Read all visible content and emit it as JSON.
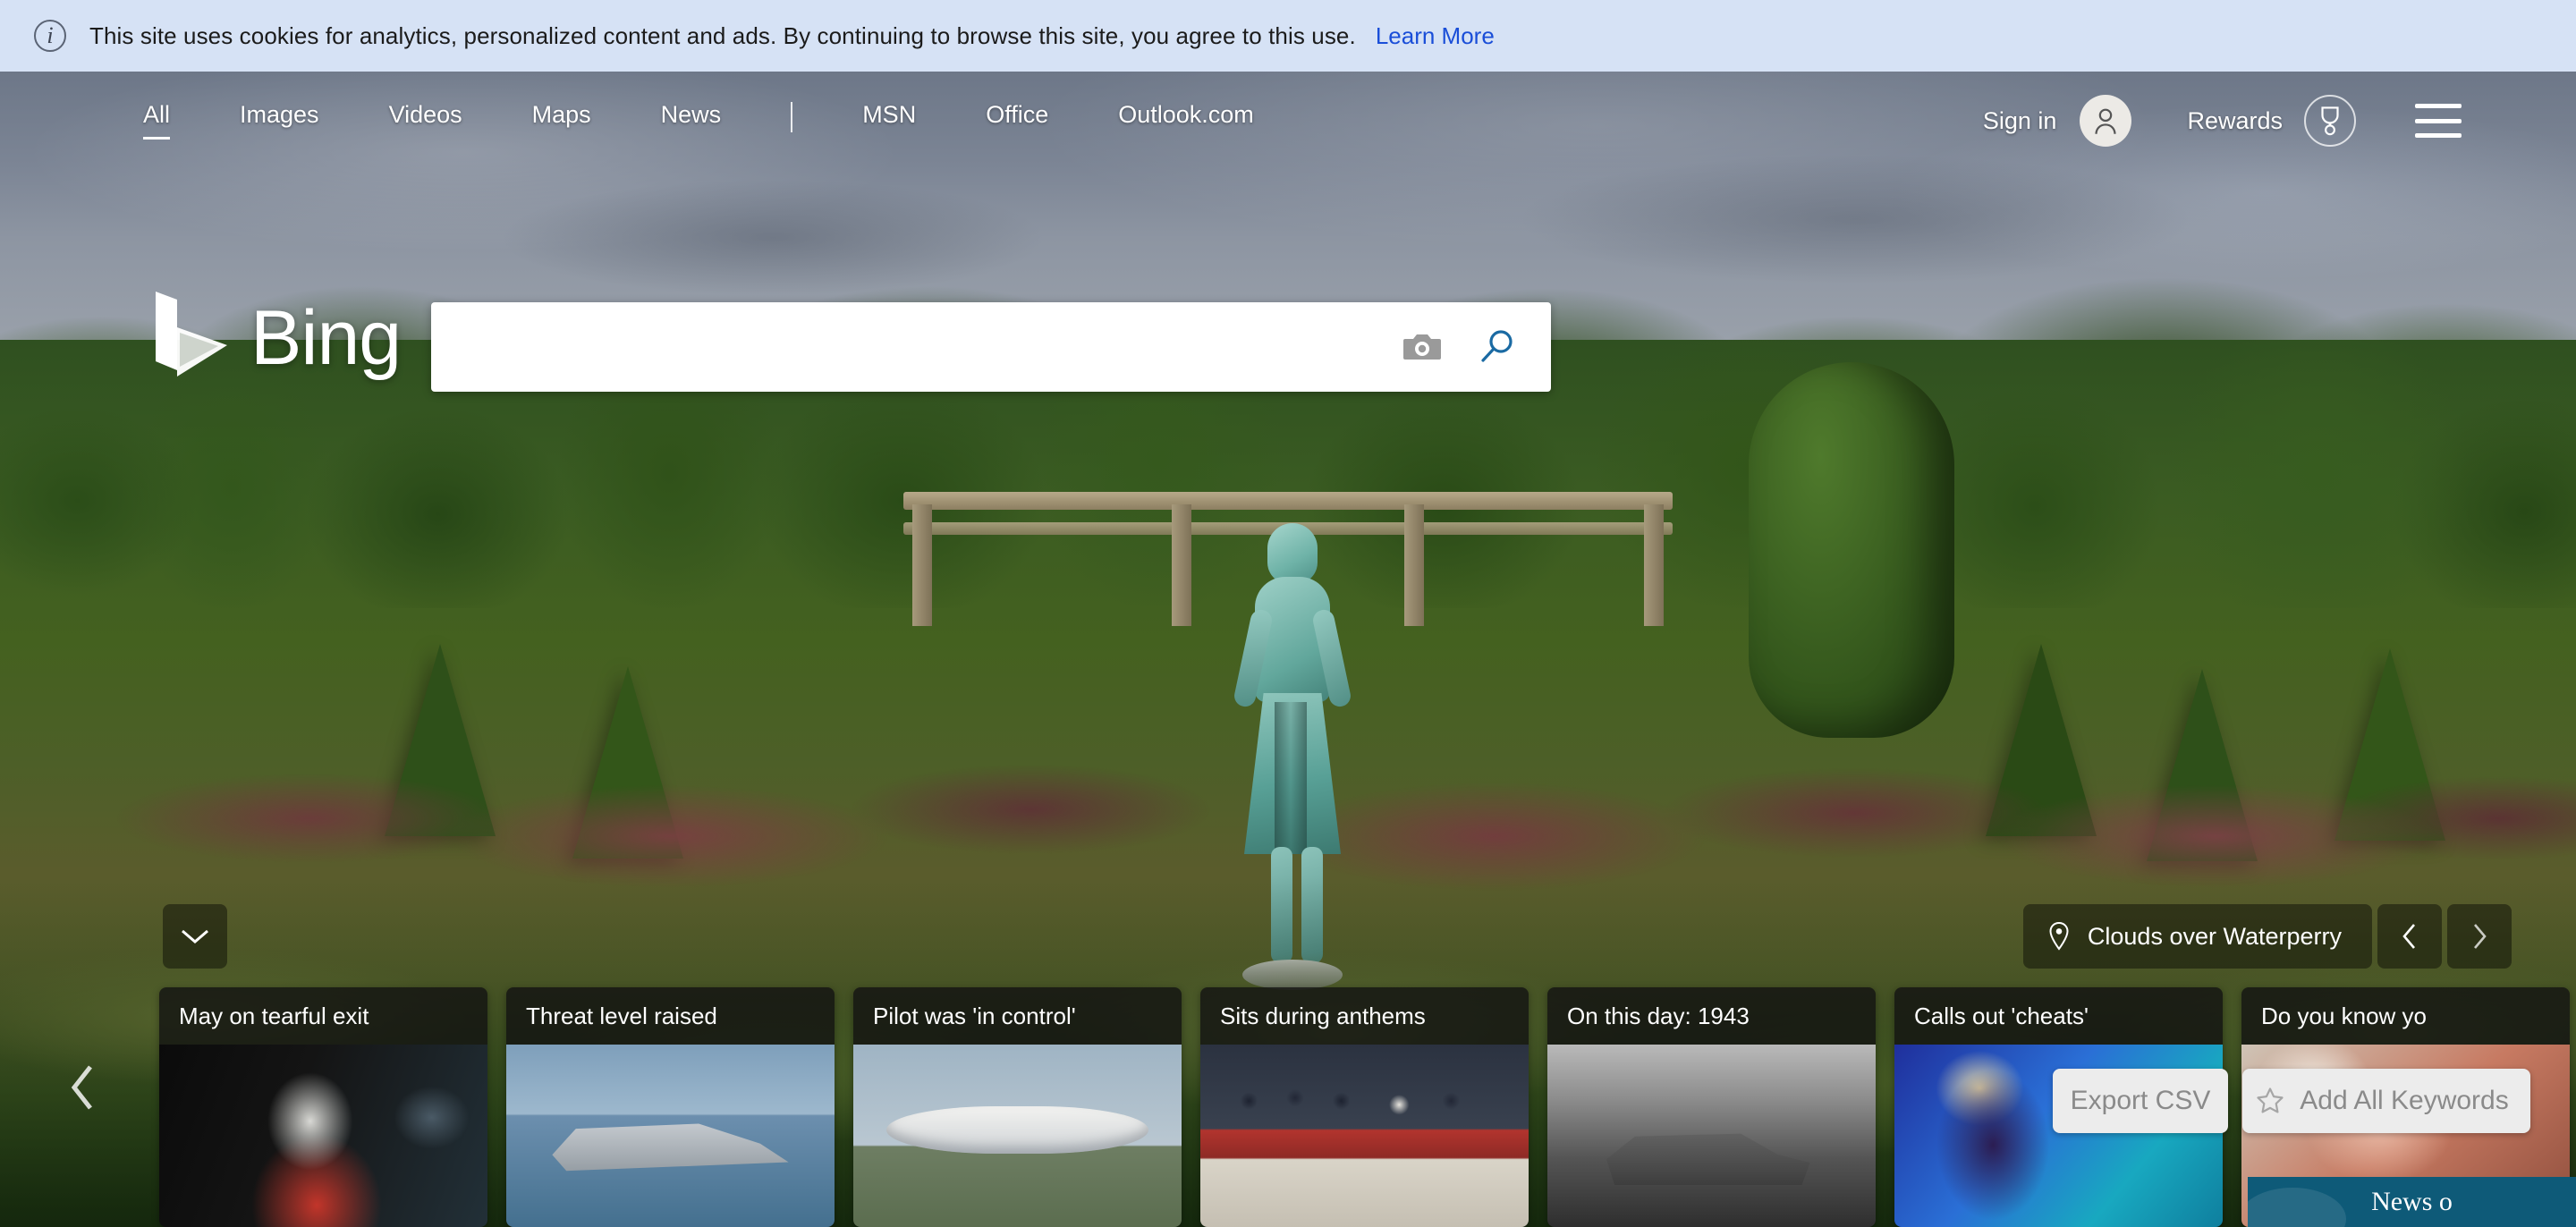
{
  "cookie_banner": {
    "icon": "info-icon",
    "message": "This site uses cookies for analytics, personalized content and ads. By continuing to browse this site, you agree to this use.",
    "link_label": "Learn More",
    "background": "#d6e2f5",
    "link_color": "#1a4ed8"
  },
  "topnav": {
    "left_items": [
      {
        "label": "All",
        "active": true
      },
      {
        "label": "Images",
        "active": false
      },
      {
        "label": "Videos",
        "active": false
      },
      {
        "label": "Maps",
        "active": false
      },
      {
        "label": "News",
        "active": false
      }
    ],
    "separator": "|",
    "right_items": [
      {
        "label": "MSN"
      },
      {
        "label": "Office"
      },
      {
        "label": "Outlook.com"
      }
    ],
    "sign_in_label": "Sign in",
    "account_icon": "person-icon",
    "rewards_label": "Rewards",
    "rewards_icon": "medal-icon",
    "menu_icon": "hamburger-menu-icon"
  },
  "brand": {
    "wordmark": "Bing",
    "logo_icon": "bing-logo-icon"
  },
  "search": {
    "value": "",
    "placeholder": "",
    "camera_icon": "camera-icon",
    "search_icon": "magnifier-icon",
    "search_icon_color": "#1a6aa3",
    "camera_icon_color": "#9a9a9a"
  },
  "hero": {
    "scroll_down_icon": "chevron-down-icon",
    "image_caption": "Clouds over Waterperry",
    "location_icon": "location-pin-icon",
    "prev_icon": "chevron-left-icon",
    "next_icon": "chevron-right-icon"
  },
  "carousel": {
    "prev_icon": "chevron-left-icon",
    "cards": [
      {
        "headline": "May on tearful exit",
        "thumb_class": "th-may"
      },
      {
        "headline": "Threat level raised",
        "thumb_class": "th-ship"
      },
      {
        "headline": "Pilot was 'in control'",
        "thumb_class": "th-plane"
      },
      {
        "headline": "Sits during anthems",
        "thumb_class": "th-anthem"
      },
      {
        "headline": "On this day: 1943",
        "thumb_class": "th-1943"
      },
      {
        "headline": "Calls out 'cheats'",
        "thumb_class": "th-taylor"
      },
      {
        "headline": "Do you know yo",
        "thumb_class": "th-know"
      }
    ]
  },
  "overlay": {
    "export_csv_label": "Export CSV",
    "add_all_keywords_label": "Add All Keywords",
    "star_icon": "star-outline-icon",
    "news_banner_label": "News o",
    "news_banner_color": "#0e5a78",
    "button_background": "#ececec",
    "button_text_color": "#8a8a8a"
  }
}
